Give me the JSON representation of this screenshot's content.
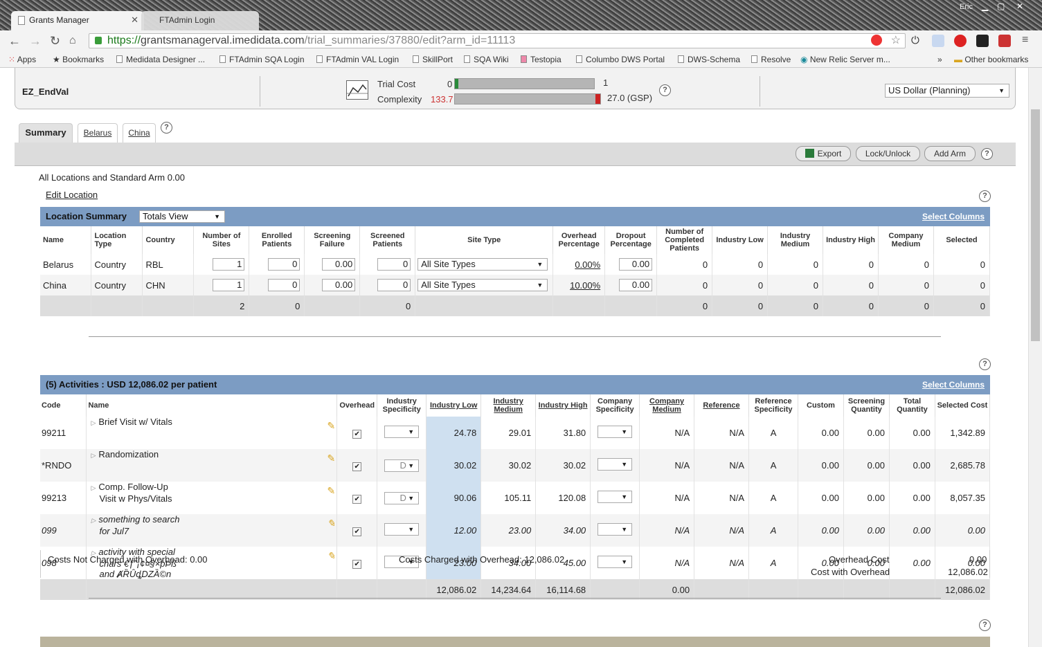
{
  "browser": {
    "tabs": [
      {
        "label": "Grants Manager"
      },
      {
        "label": "FTAdmin Login"
      }
    ],
    "user": "Eric",
    "url_scheme": "https://",
    "url_host": "grantsmanagerval.imedidata.com",
    "url_path": "/trial_summaries/37880/edit?arm_id=11113",
    "bookmarks": [
      "Apps",
      "Bookmarks",
      "Medidata Designer ...",
      "FTAdmin SQA Login",
      "FTAdmin VAL Login",
      "SkillPort",
      "SQA Wiki",
      "Testopia",
      "Columbo DWS Portal",
      "DWS-Schema",
      "Resolve",
      "New Relic Server m...",
      "»",
      "Other bookmarks"
    ]
  },
  "header": {
    "trial_name": "EZ_EndVal",
    "trial_cost_label": "Trial Cost",
    "trial_cost_value": "0",
    "trial_cost_max": "1",
    "complexity_label": "Complexity",
    "complexity_value": "133.7",
    "complexity_ref": "27.0 (GSP)",
    "currency": "US Dollar (Planning)"
  },
  "tabs": [
    {
      "label": "Summary"
    },
    {
      "label": "Belarus"
    },
    {
      "label": "China"
    }
  ],
  "toolbar": {
    "export": "Export",
    "lock": "Lock/Unlock",
    "add_arm": "Add Arm"
  },
  "location": {
    "all_text": "All Locations and Standard Arm 0.00",
    "edit_location": "Edit Location",
    "title": "Location Summary",
    "view": "Totals View",
    "select_columns": "Select Columns",
    "columns": [
      "Name",
      "Location Type",
      "Country",
      "Number of Sites",
      "Enrolled Patients",
      "Screening Failure",
      "Screened Patients",
      "Site Type",
      "Overhead Percentage",
      "Dropout Percentage",
      "Number of Completed Patients",
      "Industry Low",
      "Industry Medium",
      "Industry High",
      "Company Medium",
      "Selected"
    ],
    "rows": [
      {
        "name": "Belarus",
        "type": "Country",
        "country": "RBL",
        "sites": "1",
        "enrolled": "0",
        "fail": "0.00",
        "screened": "0",
        "site_type": "All Site Types",
        "overhead": "0.00%",
        "dropout": "0.00",
        "completed": "0",
        "low": "0",
        "medium": "0",
        "high": "0",
        "company": "0",
        "selected": "0"
      },
      {
        "name": "China",
        "type": "Country",
        "country": "CHN",
        "sites": "1",
        "enrolled": "0",
        "fail": "0.00",
        "screened": "0",
        "site_type": "All Site Types",
        "overhead": "10.00%",
        "dropout": "0.00",
        "completed": "0",
        "low": "0",
        "medium": "0",
        "high": "0",
        "company": "0",
        "selected": "0"
      }
    ],
    "totals": {
      "sites": "2",
      "enrolled": "0",
      "screened": "0",
      "completed": "0",
      "low": "0",
      "medium": "0",
      "high": "0",
      "company": "0",
      "selected": "0"
    }
  },
  "activities": {
    "title": "(5) Activities : USD 12,086.02 per patient",
    "select_columns": "Select Columns",
    "columns": [
      "Code",
      "Name",
      "Overhead",
      "Industry Specificity",
      "Industry Low",
      "Industry Medium",
      "Industry High",
      "Company Specificity",
      "Company Medium",
      "Reference",
      "Reference Specificity",
      "Custom",
      "Screening Quantity",
      "Total Quantity",
      "Selected Cost"
    ],
    "rows": [
      {
        "code": "99211",
        "name1": "Brief Visit w/ Vitals",
        "name2": "",
        "name3": "",
        "spec": "",
        "low": "24.78",
        "medium": "29.01",
        "high": "31.80",
        "company_medium": "N/A",
        "reference": "N/A",
        "ref_spec": "A",
        "custom": "0.00",
        "screening": "0.00",
        "total": "0.00",
        "selected": "1,342.89"
      },
      {
        "code": "*RNDO",
        "name1": "Randomization",
        "name2": "",
        "name3": "",
        "spec": "D",
        "low": "30.02",
        "medium": "30.02",
        "high": "30.02",
        "company_medium": "N/A",
        "reference": "N/A",
        "ref_spec": "A",
        "custom": "0.00",
        "screening": "0.00",
        "total": "0.00",
        "selected": "2,685.78"
      },
      {
        "code": "99213",
        "name1": "Comp. Follow-Up",
        "name2": "Visit w Phys/Vitals",
        "name3": "",
        "spec": "D",
        "low": "90.06",
        "medium": "105.11",
        "high": "120.08",
        "company_medium": "N/A",
        "reference": "N/A",
        "ref_spec": "A",
        "custom": "0.00",
        "screening": "0.00",
        "total": "0.00",
        "selected": "8,057.35"
      },
      {
        "code": "099",
        "name1": "something to search",
        "name2": "for Jul7",
        "name3": "",
        "spec": "",
        "low": "12.00",
        "medium": "23.00",
        "high": "34.00",
        "company_medium": "N/A",
        "reference": "N/A",
        "ref_spec": "A",
        "custom": "0.00",
        "screening": "0.00",
        "total": "0.00",
        "selected": "0.00"
      },
      {
        "code": "098",
        "name1": "activity with special",
        "name2": "chars €ƒ˜¡¢¤§×þÞß",
        "name3": "and ȺȐȖȡǱȀ©n",
        "spec": "",
        "low": "23.00",
        "medium": "34.00",
        "high": "45.00",
        "company_medium": "N/A",
        "reference": "N/A",
        "ref_spec": "A",
        "custom": "0.00",
        "screening": "0.00",
        "total": "0.00",
        "selected": "0.00"
      }
    ],
    "totals": {
      "low": "12,086.02",
      "medium": "14,234.64",
      "high": "16,114.68",
      "company_medium": "0.00",
      "selected": "12,086.02"
    },
    "costs_not_charged": "Costs Not Charged with Overhead: 0.00",
    "costs_charged": "Costs Charged with Overhead: 12,086.02",
    "overhead_cost_label": "Overhead Cost",
    "overhead_cost": "0.00",
    "cost_with_overhead_label": "Cost with Overhead",
    "cost_with_overhead": "12,086.02"
  }
}
